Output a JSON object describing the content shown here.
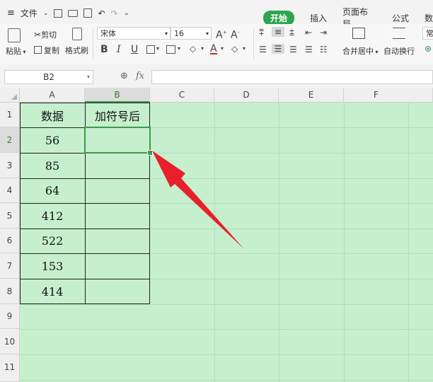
{
  "menubar": {
    "file_label": "文件",
    "tabs": [
      {
        "label": "开始",
        "active": true
      },
      {
        "label": "插入",
        "active": false
      },
      {
        "label": "页面布局",
        "active": false
      },
      {
        "label": "公式",
        "active": false
      },
      {
        "label": "数",
        "active": false
      }
    ],
    "icons": [
      "hamburger-icon",
      "chevron-down-icon",
      "save-icon",
      "print-icon",
      "preview-icon",
      "undo-icon",
      "redo-icon",
      "customize-icon"
    ]
  },
  "ribbon": {
    "paste_label": "粘贴",
    "cut_label": "剪切",
    "copy_label": "复制",
    "format_painter_label": "格式刷",
    "font_name": "宋体",
    "font_size": "16",
    "merge_center_label": "合并居中",
    "wrap_text_label": "自动换行",
    "number_format_label": "常"
  },
  "formula_bar": {
    "name_box": "B2",
    "fx_label": "fx",
    "formula_value": ""
  },
  "sheet": {
    "columns": [
      "A",
      "B",
      "C",
      "D",
      "E",
      "F"
    ],
    "rows": [
      "1",
      "2",
      "3",
      "4",
      "5",
      "6",
      "7",
      "8",
      "9",
      "10",
      "11"
    ],
    "active_cell": "B2",
    "header_a": "数据",
    "header_b": "加符号后",
    "values": [
      "56",
      "85",
      "64",
      "412",
      "522",
      "153",
      "414"
    ]
  },
  "colors": {
    "sheet_background": "#c6efce",
    "active_tab": "#2ea44f",
    "selection_border": "#3e9a48",
    "annotation_arrow": "#e8202a"
  }
}
